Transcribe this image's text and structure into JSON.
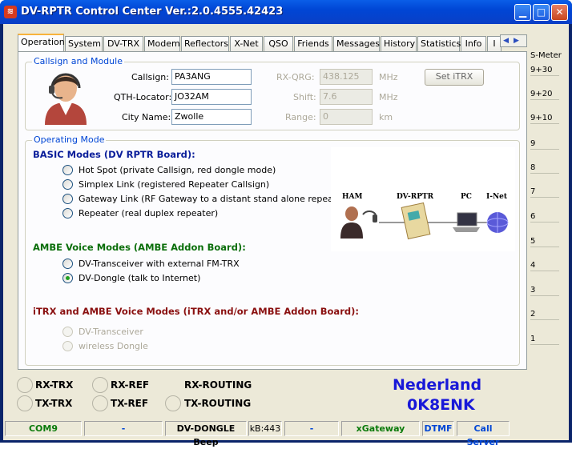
{
  "window": {
    "title": "DV-RPTR Control Center Ver.:2.0.4555.42423",
    "app_icon": "antenna-icon"
  },
  "tabs": [
    "Operation",
    "System",
    "DV-TRX",
    "Modem",
    "Reflectors",
    "X-Net",
    "QSO",
    "Friends",
    "Messages",
    "History",
    "Statistics",
    "Info",
    "I"
  ],
  "callsign_group": {
    "title": "Callsign and Module",
    "callsign_label": "Callsign:",
    "callsign": "PA3ANG",
    "qth_label": "QTH-Locator:",
    "qth": "JO32AM",
    "city_label": "City Name:",
    "city": "Zwolle",
    "rxqrg_label": "RX-QRG:",
    "rxqrg": "438.125",
    "rxqrg_unit": "MHz",
    "shift_label": "Shift:",
    "shift": "7.6",
    "shift_unit": "MHz",
    "range_label": "Range:",
    "range": "0",
    "range_unit": "km",
    "set_itrx": "Set iTRX"
  },
  "operating": {
    "title": "Operating Mode",
    "basic_title": "BASIC Modes (DV RPTR Board):",
    "basic": [
      "Hot Spot (private Callsign, red dongle mode)",
      "Simplex Link (registered Repeater Callsign)",
      "Gateway Link (RF Gateway to a distant stand alone repeater)",
      "Repeater (real duplex repeater)"
    ],
    "ambe_title": "AMBE Voice Modes (AMBE Addon Board):",
    "ambe": [
      "DV-Transceiver with external FM-TRX",
      "DV-Dongle (talk to Internet)"
    ],
    "itrx_title": "iTRX and AMBE Voice Modes (iTRX and/or AMBE Addon Board):",
    "itrx": [
      "DV-Transceiver",
      "wireless Dongle"
    ],
    "diagram": {
      "ham": "HAM",
      "dvrptr": "DV-RPTR",
      "pc": "PC",
      "inet": "I-Net"
    }
  },
  "smeter": {
    "title": "S-Meter",
    "levels": [
      "9+30",
      "9+20",
      "9+10",
      "9",
      "8",
      "7",
      "6",
      "5",
      "4",
      "3",
      "2",
      "1"
    ]
  },
  "leds": {
    "rx_trx": "RX-TRX",
    "rx_ref": "RX-REF",
    "rx_routing": "RX-ROUTING",
    "tx_trx": "TX-TRX",
    "tx_ref": "TX-REF",
    "tx_routing": "TX-ROUTING"
  },
  "country": "Nederland",
  "reflector": "0K8ENK",
  "status": {
    "port": "COM9",
    "s2": "-",
    "s3": "-",
    "dongle": "DV-DONGLE Beep",
    "kb": "kB:443",
    "s6": "-",
    "gateway": "xGateway",
    "dtmf": "DTMF",
    "callserver": "Call Server"
  },
  "colors": {
    "accent": "#0046d5",
    "section_basic": "#0a1e9a",
    "section_ambe": "#0a6e0a",
    "section_itrx": "#8a1010",
    "status_green": "#0a7a0a"
  }
}
